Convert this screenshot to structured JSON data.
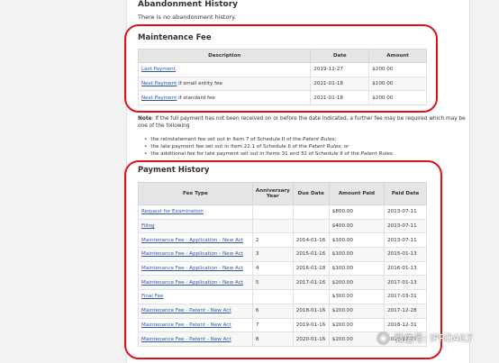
{
  "abandonment": {
    "title": "Abandonment History",
    "text": "There is no abandonment history."
  },
  "maintenance_fee": {
    "title": "Maintenance Fee",
    "headers": [
      "Description",
      "Date",
      "Amount"
    ],
    "rows": [
      {
        "link": "Last Payment",
        "suffix": "",
        "date": "2019-12-27",
        "amount": "$200.00"
      },
      {
        "link": "Next Payment",
        "suffix": " if small entity fee",
        "date": "2021-01-18",
        "amount": "$100.00"
      },
      {
        "link": "Next Payment",
        "suffix": " if standard fee",
        "date": "2021-01-18",
        "amount": "$200.00"
      }
    ]
  },
  "note": {
    "label": "Note",
    "text": ": If the full payment has not been received on or before the date indicated, a further fee may be required which may be one of the following",
    "bullets": [
      {
        "pre": "the reinstatement fee set out in Item 7 of Schedule II of the ",
        "em": "Patent Rules",
        "post": ";"
      },
      {
        "pre": "the late payment fee set out in Item 22.1 of Schedule II of the ",
        "em": "Patent Rules",
        "post": "; or"
      },
      {
        "pre": "the additional fee for late payment set out in Items 31 and 32 of Schedule II of the ",
        "em": "Patent Rules",
        "post": "."
      }
    ]
  },
  "payment_history": {
    "title": "Payment History",
    "headers": [
      "Fee Type",
      "Anniversary Year",
      "Due Date",
      "Amount Paid",
      "Paid Date"
    ],
    "rows": [
      {
        "fee": "Request for Examination",
        "year": "",
        "due": "",
        "amount": "$800.00",
        "paid": "2013-07-11"
      },
      {
        "fee": "Filing",
        "year": "",
        "due": "",
        "amount": "$400.00",
        "paid": "2013-07-11"
      },
      {
        "fee": "Maintenance Fee - Application - New Act",
        "year": "2",
        "due": "2014-01-16",
        "amount": "$100.00",
        "paid": "2013-07-11"
      },
      {
        "fee": "Maintenance Fee - Application - New Act",
        "year": "3",
        "due": "2015-01-16",
        "amount": "$100.00",
        "paid": "2015-01-13"
      },
      {
        "fee": "Maintenance Fee - Application - New Act",
        "year": "4",
        "due": "2016-01-18",
        "amount": "$100.00",
        "paid": "2016-01-13"
      },
      {
        "fee": "Maintenance Fee - Application - New Act",
        "year": "5",
        "due": "2017-01-16",
        "amount": "$200.00",
        "paid": "2017-01-13"
      },
      {
        "fee": "Final Fee",
        "year": "",
        "due": "",
        "amount": "$300.00",
        "paid": "2017-03-31"
      },
      {
        "fee": "Maintenance Fee - Patent - New Act",
        "year": "6",
        "due": "2018-01-16",
        "amount": "$200.00",
        "paid": "2017-12-28"
      },
      {
        "fee": "Maintenance Fee - Patent - New Act",
        "year": "7",
        "due": "2019-01-16",
        "amount": "$200.00",
        "paid": "2018-12-31"
      },
      {
        "fee": "Maintenance Fee - Patent - New Act",
        "year": "8",
        "due": "2020-01-16",
        "amount": "$200.00",
        "paid": "2019-12-27"
      }
    ]
  },
  "watermark": {
    "icon": "wechat-icon",
    "text": "微信号: IPRDAILY"
  },
  "colors": {
    "highlight": "#e0101a",
    "link": "#2a5aa0",
    "header_bg": "#e5e5e5"
  }
}
